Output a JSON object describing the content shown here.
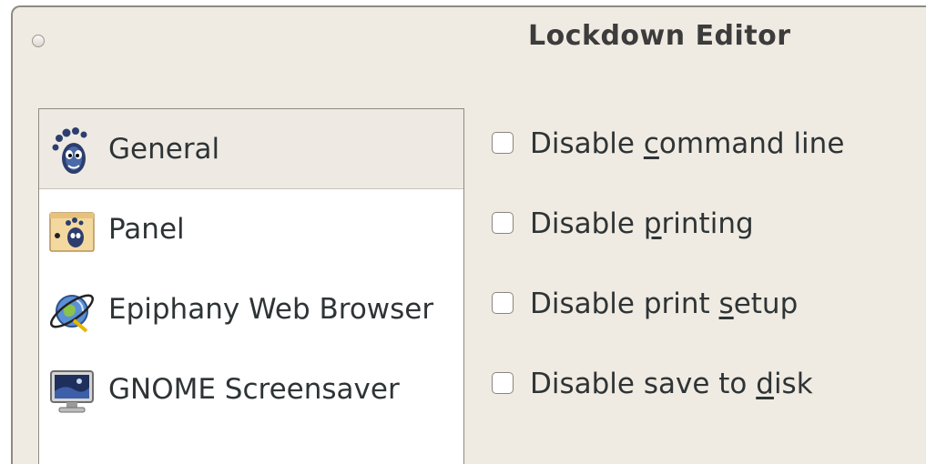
{
  "window": {
    "title": "Lockdown Editor"
  },
  "sidebar": {
    "items": [
      {
        "label": "General",
        "icon": "gnome-foot-icon",
        "selected": true
      },
      {
        "label": "Panel",
        "icon": "panel-icon",
        "selected": false
      },
      {
        "label": "Epiphany Web Browser",
        "icon": "epiphany-globe-icon",
        "selected": false
      },
      {
        "label": "GNOME Screensaver",
        "icon": "monitor-icon",
        "selected": false
      }
    ]
  },
  "options": [
    {
      "before": "Disable ",
      "mnemonic": "c",
      "after": "ommand line",
      "checked": false
    },
    {
      "before": "Disable ",
      "mnemonic": "p",
      "after": "rinting",
      "checked": false
    },
    {
      "before": "Disable print ",
      "mnemonic": "s",
      "after": "etup",
      "checked": false
    },
    {
      "before": "Disable save to ",
      "mnemonic": "d",
      "after": "isk",
      "checked": false
    }
  ]
}
